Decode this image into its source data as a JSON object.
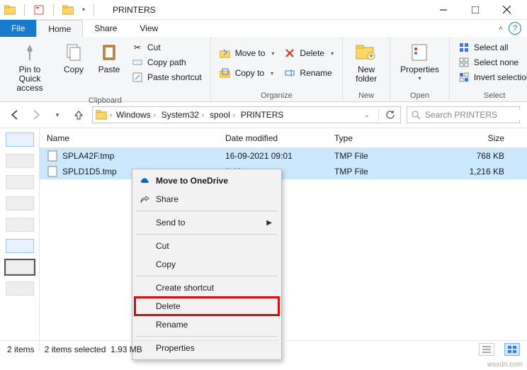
{
  "window": {
    "title": "PRINTERS"
  },
  "tabs": {
    "file": "File",
    "home": "Home",
    "share": "Share",
    "view": "View"
  },
  "ribbon": {
    "clipboard": {
      "label": "Clipboard",
      "pin": "Pin to Quick access",
      "copy": "Copy",
      "paste": "Paste",
      "cut": "Cut",
      "copy_path": "Copy path",
      "paste_shortcut": "Paste shortcut"
    },
    "organize": {
      "label": "Organize",
      "move_to": "Move to",
      "copy_to": "Copy to",
      "delete": "Delete",
      "rename": "Rename"
    },
    "new": {
      "label": "New",
      "new_folder": "New folder"
    },
    "open": {
      "label": "Open",
      "properties": "Properties"
    },
    "select": {
      "label": "Select",
      "select_all": "Select all",
      "select_none": "Select none",
      "invert": "Invert selection"
    }
  },
  "breadcrumbs": [
    "Windows",
    "System32",
    "spool",
    "PRINTERS"
  ],
  "search": {
    "placeholder": "Search PRINTERS"
  },
  "columns": {
    "name": "Name",
    "date": "Date modified",
    "type": "Type",
    "size": "Size"
  },
  "files": [
    {
      "name": "SPLA42F.tmp",
      "date": "16-09-2021 09:01",
      "type": "TMP File",
      "size": "768 KB"
    },
    {
      "name": "SPLD1D5.tmp",
      "date": "2:42",
      "type": "TMP File",
      "size": "1,216 KB"
    }
  ],
  "context_menu": {
    "move_onedrive": "Move to OneDrive",
    "share": "Share",
    "send_to": "Send to",
    "cut": "Cut",
    "copy": "Copy",
    "create_shortcut": "Create shortcut",
    "delete": "Delete",
    "rename": "Rename",
    "properties": "Properties"
  },
  "status": {
    "items": "2 items",
    "selected": "2 items selected",
    "size": "1.93 MB"
  },
  "watermark": "wsxdn.com"
}
